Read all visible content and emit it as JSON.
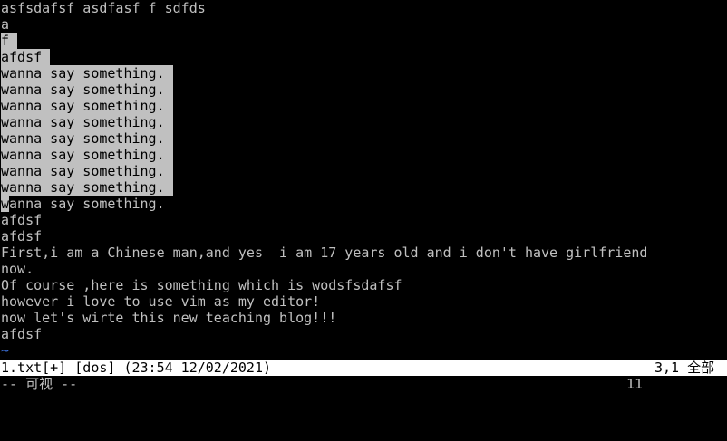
{
  "buffer": {
    "lines": [
      "asfsdafsf asdfasf f sdfds",
      "a",
      "f",
      "afdsf",
      "wanna say something.",
      "wanna say something.",
      "wanna say something.",
      "wanna say something.",
      "wanna say something.",
      "wanna say something.",
      "wanna say something.",
      "wanna say something.",
      "wanna say something.",
      "afdsf",
      "afdsf",
      "First,i am a Chinese man,and yes  i am 17 years old and i don't have girlfriend",
      "now.",
      "Of course ,here is something which is wodsfsdafsf",
      "however i love to use vim as my editor!",
      "now let's wirte this new teaching blog!!!",
      "afdsf"
    ],
    "cursor_char": "w",
    "tilde": "~"
  },
  "statusline": {
    "file_info": "1.txt[+] [dos] (23:54 12/02/2021)",
    "position": "3,1 全部"
  },
  "cmdline": {
    "mode": "-- 可视 --",
    "selection_count": "11"
  },
  "colors": {
    "background": "#000000",
    "text": "#c0c0c0",
    "selection_bg": "#c0c0c0",
    "statusline_bg": "#ffffff",
    "tilde": "#3b6fd8"
  }
}
